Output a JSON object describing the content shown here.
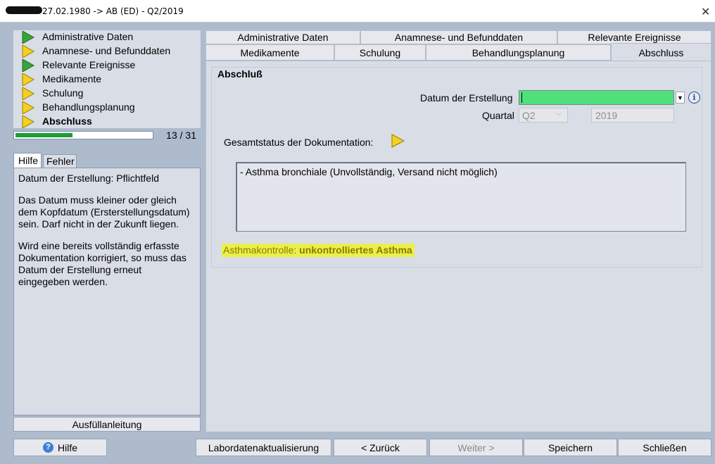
{
  "window": {
    "title": "27.02.1980 -> AB (ED) - Q2/2019",
    "close_icon": "close-icon"
  },
  "nav": {
    "items": [
      {
        "label": "Administrative Daten",
        "status": "green"
      },
      {
        "label": "Anamnese- und Befunddaten",
        "status": "yellow"
      },
      {
        "label": "Relevante Ereignisse",
        "status": "green"
      },
      {
        "label": "Medikamente",
        "status": "yellow"
      },
      {
        "label": "Schulung",
        "status": "yellow"
      },
      {
        "label": "Behandlungsplanung",
        "status": "yellow"
      },
      {
        "label": "Abschluss",
        "status": "yellow",
        "active": true
      }
    ],
    "progress_text": "13 / 31",
    "progress_fraction": 0.42
  },
  "help": {
    "tabs": [
      "Hilfe",
      "Fehler"
    ],
    "paragraphs": [
      "Datum der Erstellung: Pflichtfeld",
      "Das Datum muss kleiner oder gleich dem Kopfdatum (Ersterstellungsdatum) sein. Darf nicht in der Zukunft liegen.",
      "Wird eine bereits vollständig erfasste Dokumentation korrigiert, so muss das Datum der Erstellung erneut eingegeben werden."
    ],
    "fill_button": "Ausfüllanleitung"
  },
  "tabs": {
    "row1": [
      "Administrative Daten",
      "Anamnese- und Befunddaten",
      "Relevante Ereignisse"
    ],
    "row2": [
      "Medikamente",
      "Schulung",
      "Behandlungsplanung",
      "Abschluss"
    ]
  },
  "form": {
    "section_title": "Abschluß",
    "datum_label": "Datum der Erstellung",
    "datum_value": "",
    "quartal_label": "Quartal",
    "quartal_value": "Q2",
    "jahr_value": "2019",
    "status_label": "Gesamtstatus der Dokumentation:",
    "status_text": "- Asthma bronchiale  (Unvollständig, Versand nicht möglich)",
    "asthma_prefix": "Asthmakontrolle: ",
    "asthma_value": "unkontrolliertes Asthma"
  },
  "buttons": {
    "hilfe": "Hilfe",
    "labordaten": "Labordatenaktualisierung",
    "zurueck": "< Zurück",
    "weiter": "Weiter >",
    "speichern": "Speichern",
    "schliessen": "Schließen"
  },
  "colors": {
    "green": "#3aa33a",
    "yellow": "#f3d21f",
    "highlight": "#e9f04a",
    "datum_field": "#4fe07b"
  }
}
